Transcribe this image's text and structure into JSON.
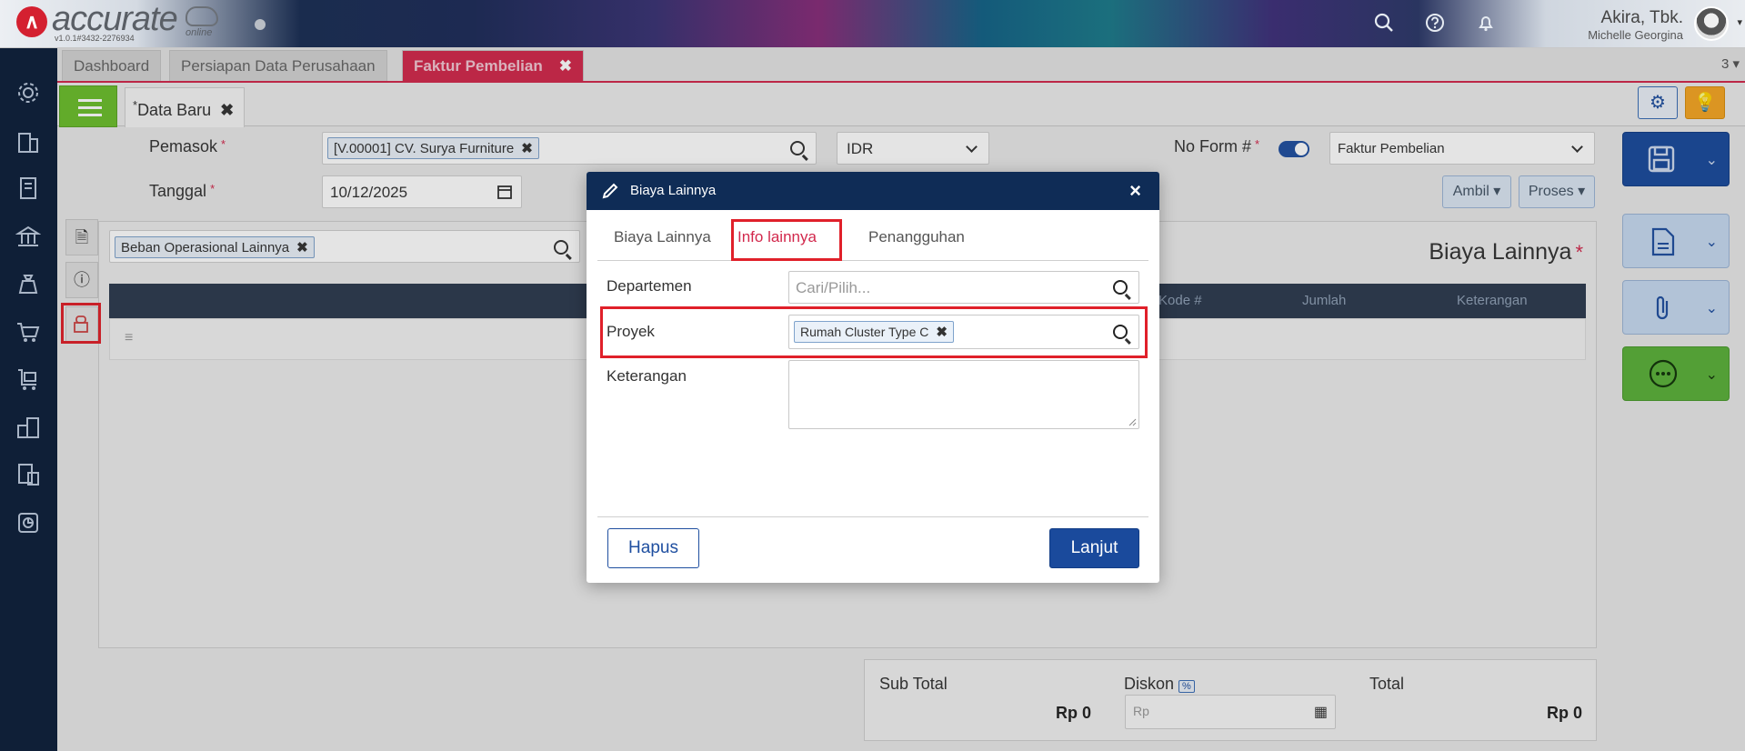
{
  "app": {
    "logo_letter": "∧",
    "brand": "accurate",
    "brand_sub": "online",
    "version": "v1.0.1#3432-2276934",
    "user_company": "Akira, Tbk.",
    "user_name": "Michelle Georgina"
  },
  "tabs": [
    {
      "label": "Dashboard"
    },
    {
      "label": "Persiapan Data Perusahaan"
    },
    {
      "label": "Faktur Pembelian",
      "active": true
    }
  ],
  "tab_count": "3",
  "doc_tab": {
    "marker": "*",
    "label": "Data Baru"
  },
  "form": {
    "pemasok_label": "Pemasok",
    "pemasok_value": "[V.00001] CV. Surya Furniture",
    "currency": "IDR",
    "noform_label": "No Form #",
    "form_type": "Faktur Pembelian",
    "tanggal_label": "Tanggal",
    "tanggal_value": "10/12/2025",
    "ambil_label": "Ambil",
    "proses_label": "Proses",
    "required_mark": "*"
  },
  "grid": {
    "filter_chip": "Beban Operasional Lainnya",
    "title": "Biaya Lainnya",
    "columns": [
      "Kode #",
      "Jumlah",
      "Keterangan"
    ]
  },
  "totals": {
    "subtotal_label": "Sub Total",
    "subtotal_value": "Rp 0",
    "diskon_label": "Diskon",
    "diskon_badge": "%",
    "diskon_placeholder": "Rp",
    "total_label": "Total",
    "total_value": "Rp 0"
  },
  "modal": {
    "title": "Biaya Lainnya",
    "close": "×",
    "tabs": [
      {
        "label": "Biaya Lainnya"
      },
      {
        "label": "Info lainnya",
        "active": true
      },
      {
        "label": "Penangguhan"
      }
    ],
    "departemen_label": "Departemen",
    "departemen_placeholder": "Cari/Pilih...",
    "proyek_label": "Proyek",
    "proyek_value": "Rumah Cluster Type C",
    "keterangan_label": "Keterangan",
    "keterangan_value": "",
    "hapus_label": "Hapus",
    "lanjut_label": "Lanjut"
  },
  "colors": {
    "accent_tab": "#d2284c",
    "modal_header": "#0f2c56",
    "primary_button": "#1a4a9c",
    "highlight": "#e0202a",
    "sidebar": "#0f1f37"
  }
}
